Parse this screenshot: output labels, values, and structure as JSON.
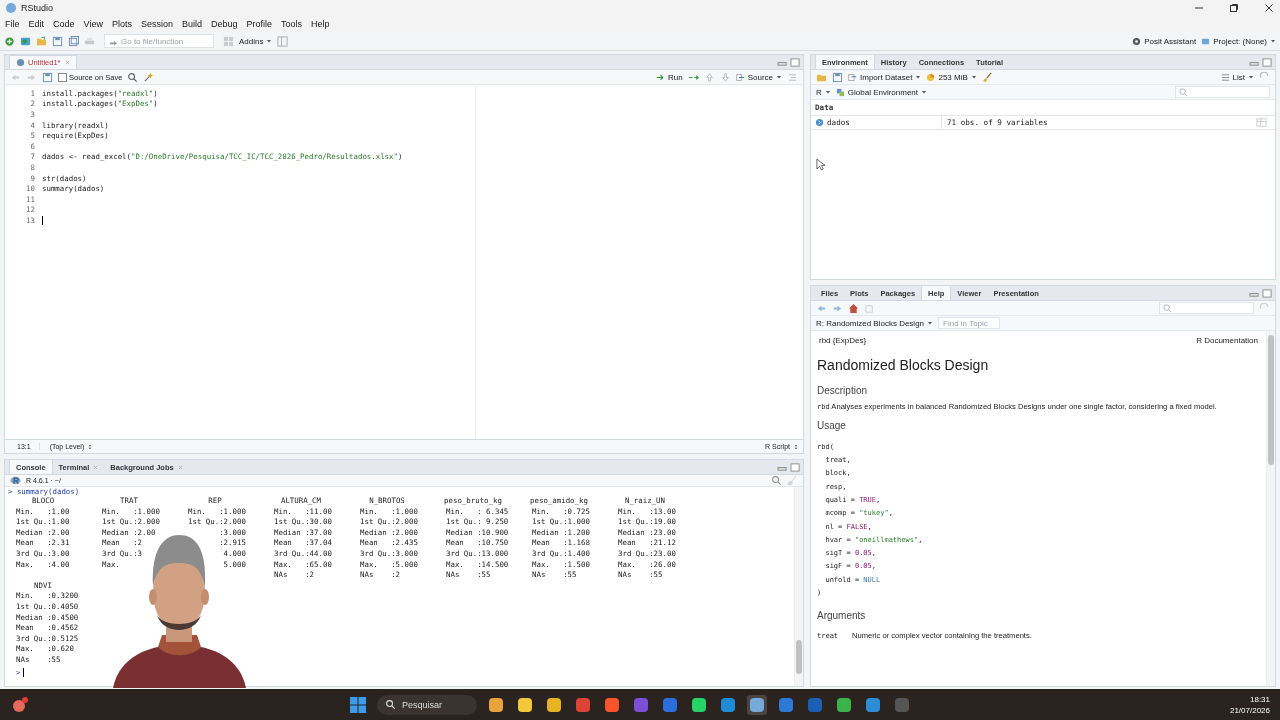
{
  "window": {
    "title": "RStudio"
  },
  "menu": [
    "File",
    "Edit",
    "Code",
    "View",
    "Plots",
    "Session",
    "Build",
    "Debug",
    "Profile",
    "Tools",
    "Help"
  ],
  "toolbar": {
    "goto_placeholder": "Go to file/function",
    "addins": "Addins",
    "assistant": "Posit Assistant",
    "project": "Project: (None)"
  },
  "editor": {
    "tabs": [
      {
        "label": "Untitled1*",
        "selected": true
      }
    ],
    "source_on_save": {
      "label": "Source on Save",
      "checked": false
    },
    "run": "Run",
    "source": "Source",
    "lines": [
      {
        "n": "1",
        "tokens": [
          {
            "kind": "plain",
            "text": "install.packages("
          },
          {
            "kind": "string",
            "text": "\"readxl\""
          },
          {
            "kind": "plain",
            "text": ")"
          }
        ]
      },
      {
        "n": "2",
        "tokens": [
          {
            "kind": "plain",
            "text": "install.packages("
          },
          {
            "kind": "string",
            "text": "\"ExpDes\""
          },
          {
            "kind": "plain",
            "text": ")"
          }
        ]
      },
      {
        "n": "3"
      },
      {
        "n": "4",
        "tokens": [
          {
            "kind": "plain",
            "text": "library(readxl)"
          }
        ]
      },
      {
        "n": "5",
        "tokens": [
          {
            "kind": "plain",
            "text": "require(ExpDes)"
          }
        ]
      },
      {
        "n": "6"
      },
      {
        "n": "7",
        "tokens": [
          {
            "kind": "plain",
            "text": "dados <- read_excel("
          },
          {
            "kind": "string",
            "text": "\"D:/OneDrive/Pesquisa/TCC_IC/TCC_2026_Pedro/Resultados.xlsx\""
          },
          {
            "kind": "plain",
            "text": ")"
          }
        ]
      },
      {
        "n": "8"
      },
      {
        "n": "9",
        "tokens": [
          {
            "kind": "plain",
            "text": "str(dados)"
          }
        ]
      },
      {
        "n": "10",
        "tokens": [
          {
            "kind": "plain",
            "text": "summary(dados)"
          }
        ]
      },
      {
        "n": "11"
      },
      {
        "n": "12"
      },
      {
        "n": "13"
      }
    ],
    "status": {
      "position": "13:1",
      "scope": "(Top Level)",
      "filetype": "R Script"
    }
  },
  "console": {
    "tabs": [
      {
        "label": "Console",
        "selected": true,
        "closable": false
      },
      {
        "label": "Terminal",
        "selected": false,
        "closable": true
      },
      {
        "label": "Background Jobs",
        "selected": false,
        "closable": true
      }
    ],
    "version": "R 4.6.1 · ~/",
    "command": "> summary(dados)",
    "blocks": [
      [
        {
          "header": "BLOCO",
          "rows": [
            "Min.   :1.00",
            "1st Qu.:1.00",
            "Median :2.00",
            "Mean   :2.31",
            "3rd Qu.:3.00",
            "Max.   :4.00"
          ]
        },
        {
          "header": "TRAT",
          "rows": [
            "Min.   :1.000",
            "1st Qu.:2.000",
            "Median :2.00",
            "Mean   :2",
            "3rd Qu.:3",
            "Max."
          ]
        },
        {
          "header": "REP",
          "rows": [
            "Min.   :1.000",
            "1st Qu.:2.000",
            "       :3.000",
            "       :2.915",
            "        4.000",
            "        5.000"
          ]
        },
        {
          "header": "ALTURA_CM",
          "rows": [
            "Min.   :11.00",
            "1st Qu.:30.00",
            "Median :37.00",
            "Mean   :37.04",
            "3rd Qu.:44.00",
            "Max.   :65.00",
            "NAs    :2"
          ]
        },
        {
          "header": "N_BROTOS",
          "rows": [
            "Min.   :1.000",
            "1st Qu.:2.000",
            "Median :2.000",
            "Mean   :2.435",
            "3rd Qu.:3.000",
            "Max.   :5.000",
            "NAs    :2"
          ]
        },
        {
          "header": "peso_bruto_kg",
          "rows": [
            "Min.   : 6.345",
            "1st Qu.: 9.250",
            "Median :10.900",
            "Mean   :10.750",
            "3rd Qu.:13.000",
            "Max.   :14.500",
            "NAs    :55"
          ]
        },
        {
          "header": "peso_amido_kg",
          "rows": [
            "Min.   :0.725",
            "1st Qu.:1.000",
            "Median :1.200",
            "Mean   :1.168",
            "3rd Qu.:1.400",
            "Max.   :1.500",
            "NAs    :55"
          ]
        },
        {
          "header": "N_raiz_UN",
          "rows": [
            "Min.   :13.00",
            "1st Qu.:19.00",
            "Median :23.00",
            "Mean   :21.12",
            "3rd Qu.:23.00",
            "Max.   :26.00",
            "NAs    :55"
          ]
        }
      ],
      [
        {
          "header": "NDVI",
          "rows": [
            "Min.   :0.3200",
            "1st Qu.:0.4050",
            "Median :0.4500",
            "Mean   :0.4562",
            "3rd Qu.:0.5125",
            "Max.   :0.620",
            "NAs    :55"
          ]
        }
      ]
    ],
    "prompt": ">"
  },
  "environment": {
    "tabs": [
      {
        "label": "Environment",
        "selected": true
      },
      {
        "label": "History",
        "selected": false
      },
      {
        "label": "Connections",
        "selected": false
      },
      {
        "label": "Tutorial",
        "selected": false
      }
    ],
    "import": "Import Dataset",
    "memory": "253 MiB",
    "view": "List",
    "language": "R",
    "scope": "Global Environment",
    "section": "Data",
    "rows": [
      {
        "name": "dados",
        "value": "71 obs. of 9 variables"
      }
    ]
  },
  "help_pane": {
    "tabs": [
      {
        "label": "Files",
        "selected": false
      },
      {
        "label": "Plots",
        "selected": false
      },
      {
        "label": "Packages",
        "selected": false
      },
      {
        "label": "Help",
        "selected": true
      },
      {
        "label": "Viewer",
        "selected": false
      },
      {
        "label": "Presentation",
        "selected": false
      }
    ],
    "topic": "R: Randomized Blocks Design",
    "find_placeholder": "Find in Topic",
    "doc": {
      "package": "rbd {ExpDes}",
      "source": "R Documentation",
      "title": "Randomized Blocks Design",
      "description_heading": "Description",
      "description_code": "rbd",
      "description": "Analyses experiments in balanced Randomized Blocks Designs under one single factor, considering a fixed model.",
      "usage_heading": "Usage",
      "usage": [
        [
          {
            "kind": "plain",
            "text": "rbd("
          }
        ],
        [
          {
            "kind": "plain",
            "text": "  treat,"
          }
        ],
        [
          {
            "kind": "plain",
            "text": "  block,"
          }
        ],
        [
          {
            "kind": "plain",
            "text": "  resp,"
          }
        ],
        [
          {
            "kind": "plain",
            "text": "  quali = "
          },
          {
            "kind": "keyword",
            "text": "TRUE"
          },
          {
            "kind": "plain",
            "text": ","
          }
        ],
        [
          {
            "kind": "plain",
            "text": "  mcomp = "
          },
          {
            "kind": "string",
            "text": "\"tukey\""
          },
          {
            "kind": "plain",
            "text": ","
          }
        ],
        [
          {
            "kind": "plain",
            "text": "  nl = "
          },
          {
            "kind": "keyword",
            "text": "FALSE"
          },
          {
            "kind": "plain",
            "text": ","
          }
        ],
        [
          {
            "kind": "plain",
            "text": "  hvar = "
          },
          {
            "kind": "string",
            "text": "\"oneillmathews\""
          },
          {
            "kind": "plain",
            "text": ","
          }
        ],
        [
          {
            "kind": "plain",
            "text": "  sigT = "
          },
          {
            "kind": "keyword",
            "text": "0.05"
          },
          {
            "kind": "plain",
            "text": ","
          }
        ],
        [
          {
            "kind": "plain",
            "text": "  sigF = "
          },
          {
            "kind": "keyword",
            "text": "0.05"
          },
          {
            "kind": "plain",
            "text": ","
          }
        ],
        [
          {
            "kind": "plain",
            "text": "  unfold = "
          },
          {
            "kind": "null",
            "text": "NULL"
          }
        ],
        [
          {
            "kind": "plain",
            "text": ")"
          }
        ]
      ],
      "arguments_heading": "Arguments",
      "arguments": [
        {
          "name": "treat",
          "text": "Numeric or complex vector containing the treatments."
        }
      ]
    }
  },
  "taskbar": {
    "search_placeholder": "Pesquisar",
    "time": "18:31",
    "date": "21/07/2026"
  }
}
